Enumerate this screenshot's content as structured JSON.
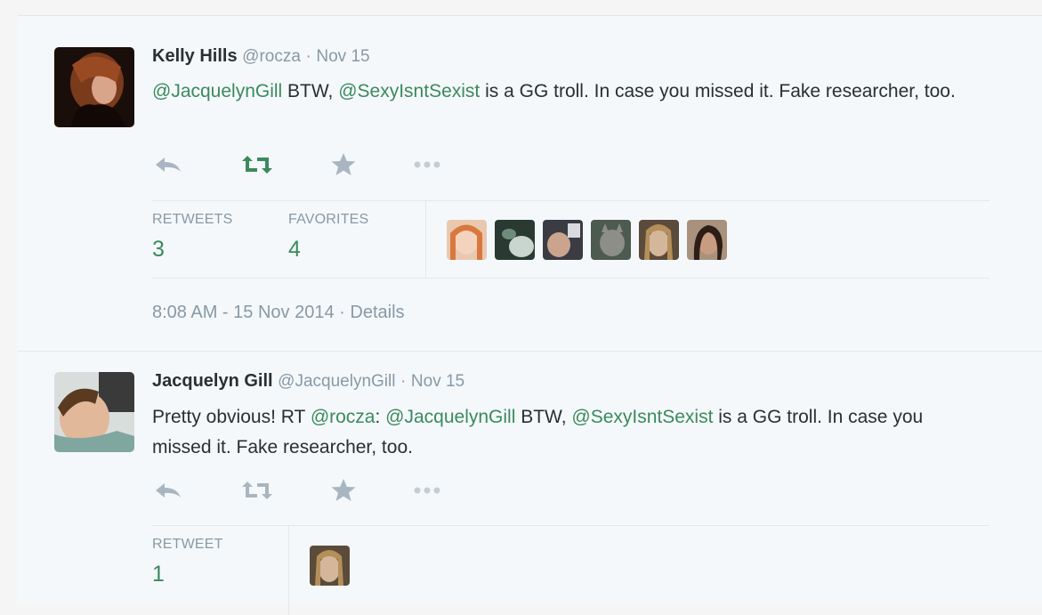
{
  "tweets": [
    {
      "fullname": "Kelly Hills",
      "username": "@rocza",
      "separator": "·",
      "time": "Nov 15",
      "text_parts": [
        {
          "t": "@JacquelynGill",
          "mention": true
        },
        {
          "t": " BTW, ",
          "mention": false
        },
        {
          "t": "@SexyIsntSexist",
          "mention": true
        },
        {
          "t": " is a GG troll. In case you missed it. Fake researcher, too.",
          "mention": false
        }
      ],
      "retweets_label": "RETWEETS",
      "retweets_count": "3",
      "favorites_label": "FAVORITES",
      "favorites_count": "4",
      "timestamp": "8:08 AM - 15 Nov 2014",
      "details_sep": "·",
      "details_label": "Details"
    },
    {
      "fullname": "Jacquelyn Gill",
      "username": "@JacquelynGill",
      "separator": "·",
      "time": "Nov 15",
      "text_parts": [
        {
          "t": "Pretty obvious! RT ",
          "mention": false
        },
        {
          "t": "@rocza",
          "mention": true
        },
        {
          "t": ": ",
          "mention": false
        },
        {
          "t": "@JacquelynGill",
          "mention": true
        },
        {
          "t": " BTW, ",
          "mention": false
        },
        {
          "t": "@SexyIsntSexist",
          "mention": true
        },
        {
          "t": " is a GG troll. In case you missed it. Fake researcher, too.",
          "mention": false
        }
      ],
      "retweets_label": "RETWEET",
      "retweets_count": "1"
    }
  ],
  "icons": [
    "reply-icon",
    "retweet-icon",
    "favorite-icon",
    "more-icon"
  ],
  "colors": {
    "mention": "#3a8a5e",
    "retweet_active": "#3a8a5e",
    "icon_inactive": "#a9b6c1",
    "muted_text": "#8899a6"
  }
}
